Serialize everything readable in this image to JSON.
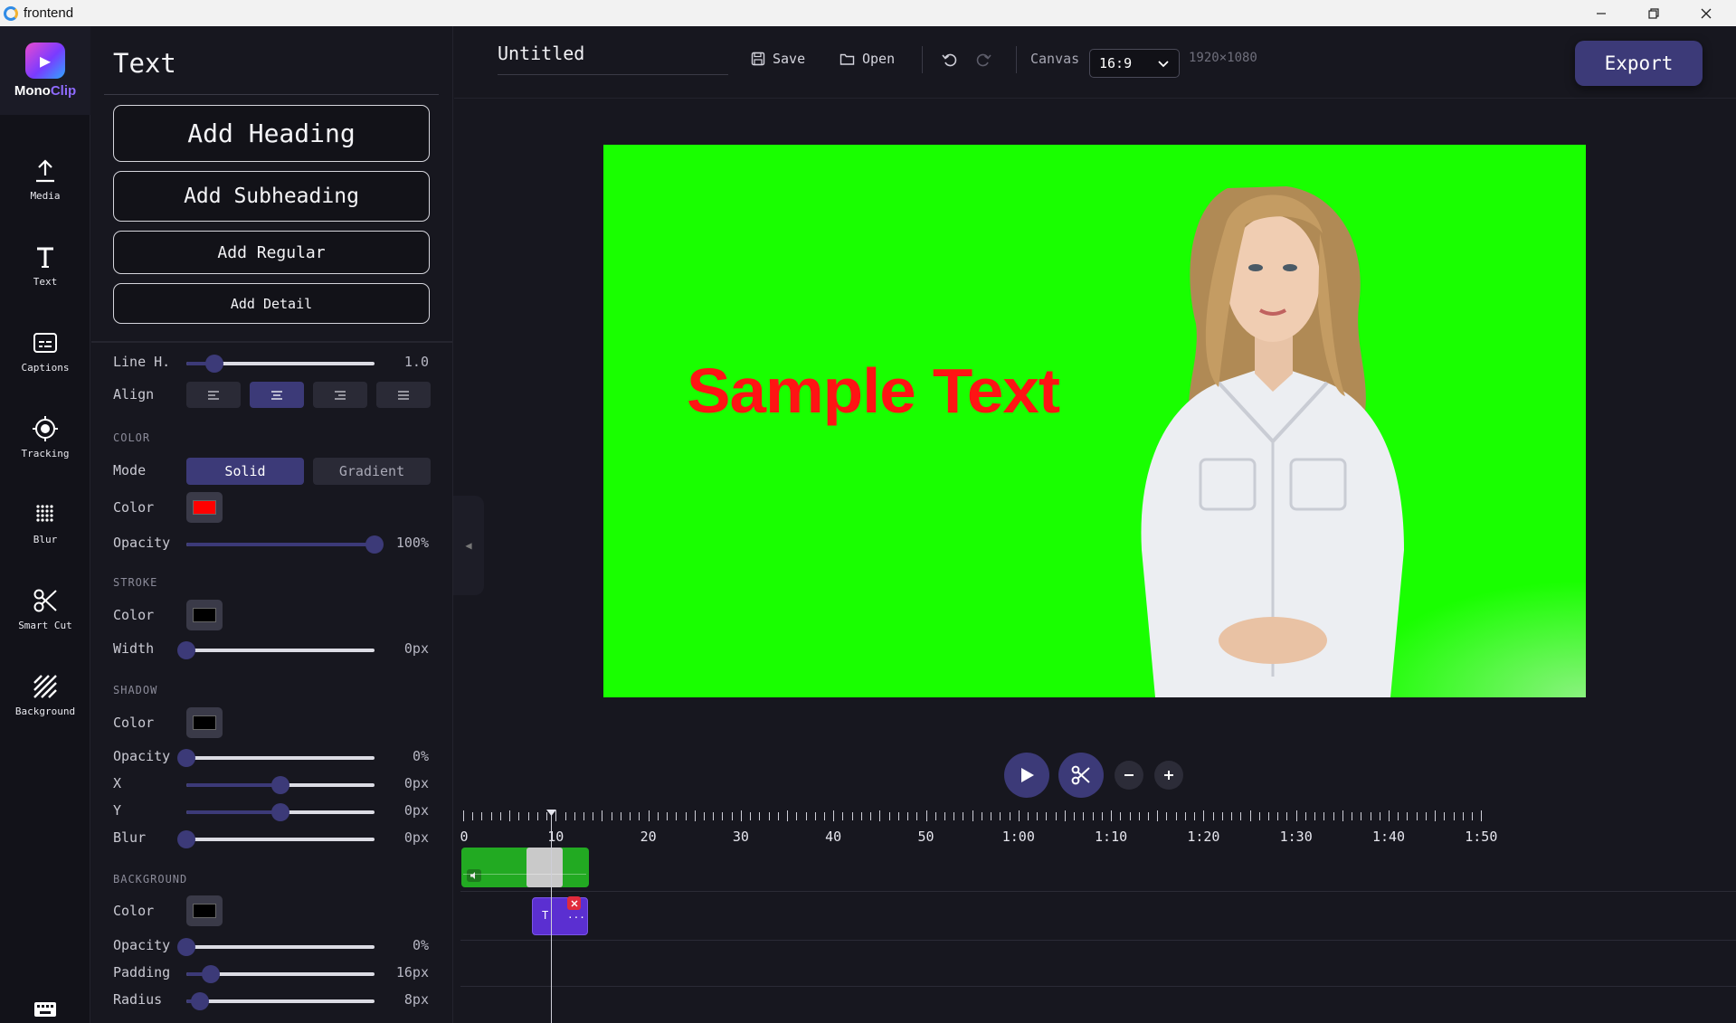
{
  "window": {
    "title": "frontend"
  },
  "brand": {
    "name_a": "Mono",
    "name_b": "Clip"
  },
  "rail": [
    {
      "label": "Media",
      "icon": "upload-icon"
    },
    {
      "label": "Text",
      "icon": "text-icon"
    },
    {
      "label": "Captions",
      "icon": "captions-icon"
    },
    {
      "label": "Tracking",
      "icon": "tracking-icon"
    },
    {
      "label": "Blur",
      "icon": "blur-icon"
    },
    {
      "label": "Smart Cut",
      "icon": "scissors-icon"
    },
    {
      "label": "Background",
      "icon": "background-icon"
    }
  ],
  "panel": {
    "title": "Text",
    "buttons": {
      "heading": "Add Heading",
      "subheading": "Add Subheading",
      "regular": "Add Regular",
      "detail": "Add Detail"
    },
    "line_height": {
      "label": "Line H.",
      "value": "1.0",
      "level": 0.15
    },
    "align": {
      "label": "Align",
      "active": "center"
    },
    "color": {
      "section": "COLOR",
      "mode_label": "Mode",
      "mode_solid": "Solid",
      "mode_gradient": "Gradient",
      "color_label": "Color",
      "color_value": "#ff0000",
      "opacity_label": "Opacity",
      "opacity_value": "100%",
      "opacity_level": 1.0
    },
    "stroke": {
      "section": "STROKE",
      "color_label": "Color",
      "color_value": "#000000",
      "width_label": "Width",
      "width_value": "0px",
      "width_level": 0.0
    },
    "shadow": {
      "section": "SHADOW",
      "color_label": "Color",
      "color_value": "#000000",
      "opacity_label": "Opacity",
      "opacity_value": "0%",
      "opacity_level": 0.0,
      "x_label": "X",
      "x_value": "0px",
      "x_level": 0.5,
      "y_label": "Y",
      "y_value": "0px",
      "y_level": 0.5,
      "blur_label": "Blur",
      "blur_value": "0px",
      "blur_level": 0.0
    },
    "background": {
      "section": "BACKGROUND",
      "color_label": "Color",
      "color_value": "#000000",
      "opacity_label": "Opacity",
      "opacity_value": "0%",
      "opacity_level": 0.0,
      "padding_label": "Padding",
      "padding_value": "16px",
      "padding_level": 0.13,
      "radius_label": "Radius",
      "radius_value": "8px",
      "radius_level": 0.07
    }
  },
  "toolbar": {
    "project_name": "Untitled",
    "save": "Save",
    "open": "Open",
    "canvas_label": "Canvas",
    "canvas_ratio": "16:9",
    "canvas_size": "1920×1080",
    "export": "Export"
  },
  "preview": {
    "background_color": "#19ff00",
    "overlay_text": "Sample Text",
    "overlay_text_color": "#ff1414"
  },
  "timeline": {
    "labels": [
      "0",
      "10",
      "20",
      "30",
      "40",
      "50",
      "1:00",
      "1:10",
      "1:20",
      "1:30",
      "1:40",
      "1:50"
    ],
    "text_clip_label": "T",
    "text_clip_more": "..."
  }
}
